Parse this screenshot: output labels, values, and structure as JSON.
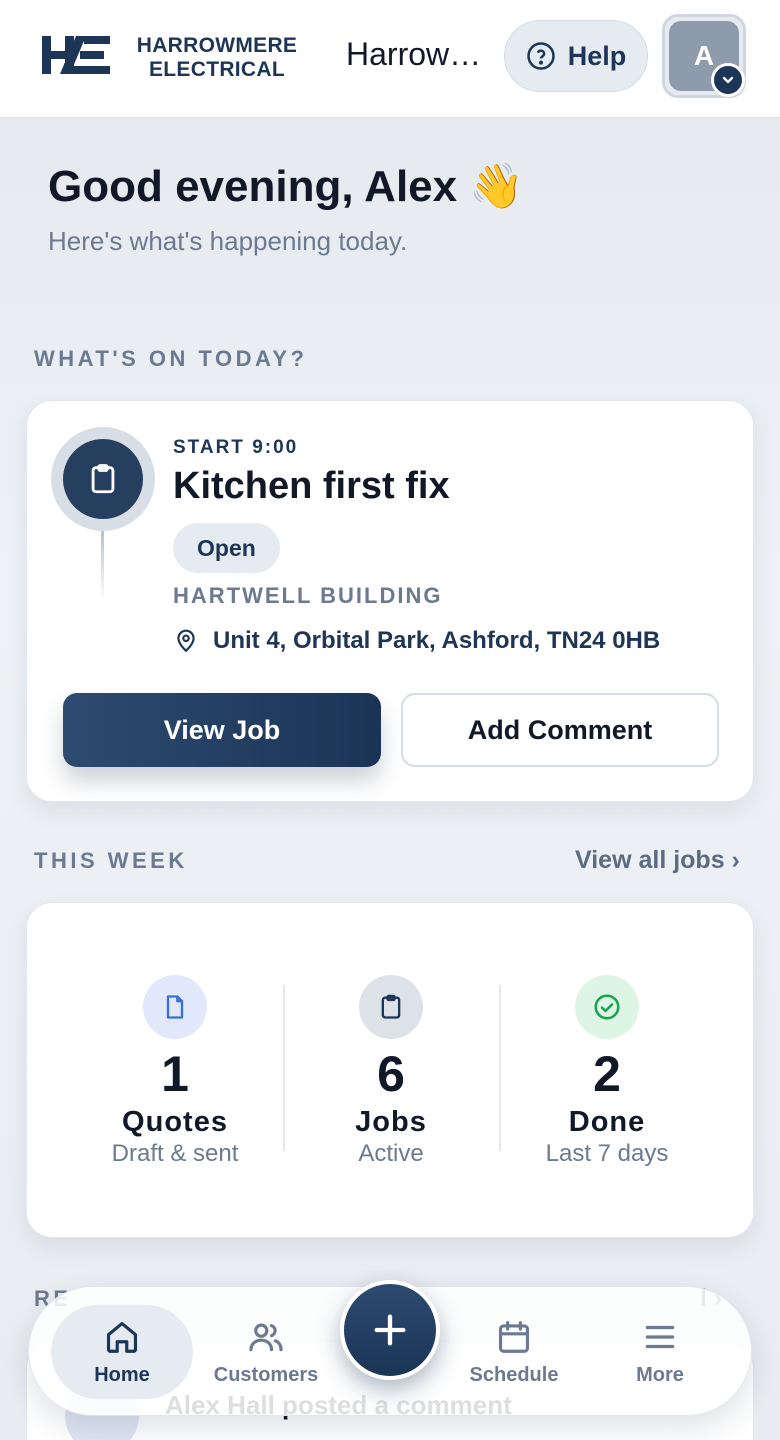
{
  "header": {
    "brand_line1": "HARROWMERE",
    "brand_line2": "ELECTRICAL",
    "brand_short": "Harrowmere Electrical",
    "help_label": "Help",
    "avatar_initial": "A"
  },
  "greeting": {
    "title": "Good evening, Alex 👋",
    "subtitle": "Here's what's happening today."
  },
  "today": {
    "section_title": "WHAT'S ON TODAY?",
    "job": {
      "start": "START 9:00",
      "title": "Kitchen first fix",
      "status": "Open",
      "client": "HARTWELL BUILDING",
      "address": "Unit 4, Orbital Park, Ashford, TN24 0HB",
      "view_label": "View Job",
      "comment_label": "Add Comment"
    }
  },
  "week": {
    "section_title": "THIS WEEK",
    "link_label": "View all jobs ›",
    "stats": [
      {
        "value": "1",
        "label": "Quotes",
        "sub": "Draft & sent",
        "icon": "document-icon",
        "color": "#3b6fd8",
        "bg": "#e1e8fb"
      },
      {
        "value": "6",
        "label": "Jobs",
        "sub": "Active",
        "icon": "clipboard-icon",
        "color": "#1d3557",
        "bg": "#dde2e9"
      },
      {
        "value": "2",
        "label": "Done",
        "sub": "Last 7 days",
        "icon": "check-circle-icon",
        "color": "#16a34a",
        "bg": "#dcf5e4"
      }
    ]
  },
  "recent": {
    "section_title": "RE",
    "link_label": "l ›",
    "first_item": "Alex Hall posted a comment"
  },
  "nav": {
    "items": [
      {
        "label": "Home",
        "icon": "home-icon",
        "active": true
      },
      {
        "label": "Customers",
        "icon": "users-icon"
      },
      {
        "label": "Schedule",
        "icon": "calendar-icon"
      },
      {
        "label": "More",
        "icon": "menu-icon"
      }
    ],
    "fab_icon": "plus-icon"
  },
  "colors": {
    "primary": "#1d3557",
    "muted": "#6b7a90",
    "background": "#eef1f5"
  }
}
